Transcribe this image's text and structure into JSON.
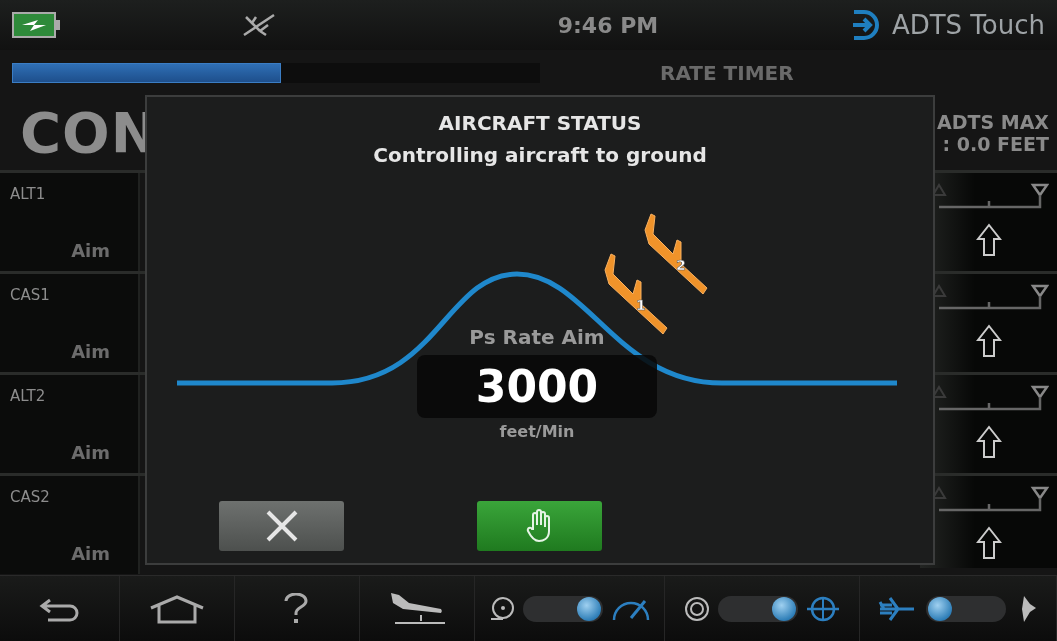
{
  "status_bar": {
    "time": "9:46 PM",
    "brand": "ADTS Touch"
  },
  "progress": {
    "level": 0.51
  },
  "rate_timer": "RATE TIMER",
  "title": "CON",
  "limits": "ADTS MAX",
  "altitude_correction": ": 0.0 FEET",
  "channels": [
    {
      "name": "ALT1",
      "aim_label": "Aim"
    },
    {
      "name": "CAS1",
      "aim_label": "Aim"
    },
    {
      "name": "ALT2",
      "aim_label": "Aim"
    },
    {
      "name": "CAS2",
      "aim_label": "Aim"
    }
  ],
  "dialog": {
    "title": "AIRCRAFT STATUS",
    "message": "Controlling aircraft to ground",
    "field_label": "Ps Rate Aim",
    "value": "3000",
    "unit": "feet/Min",
    "planes": [
      {
        "label": "1"
      },
      {
        "label": "2"
      }
    ]
  },
  "toggles": [
    {
      "kind": "rate",
      "on": true
    },
    {
      "kind": "display",
      "on": true
    },
    {
      "kind": "mode",
      "on": false
    }
  ]
}
